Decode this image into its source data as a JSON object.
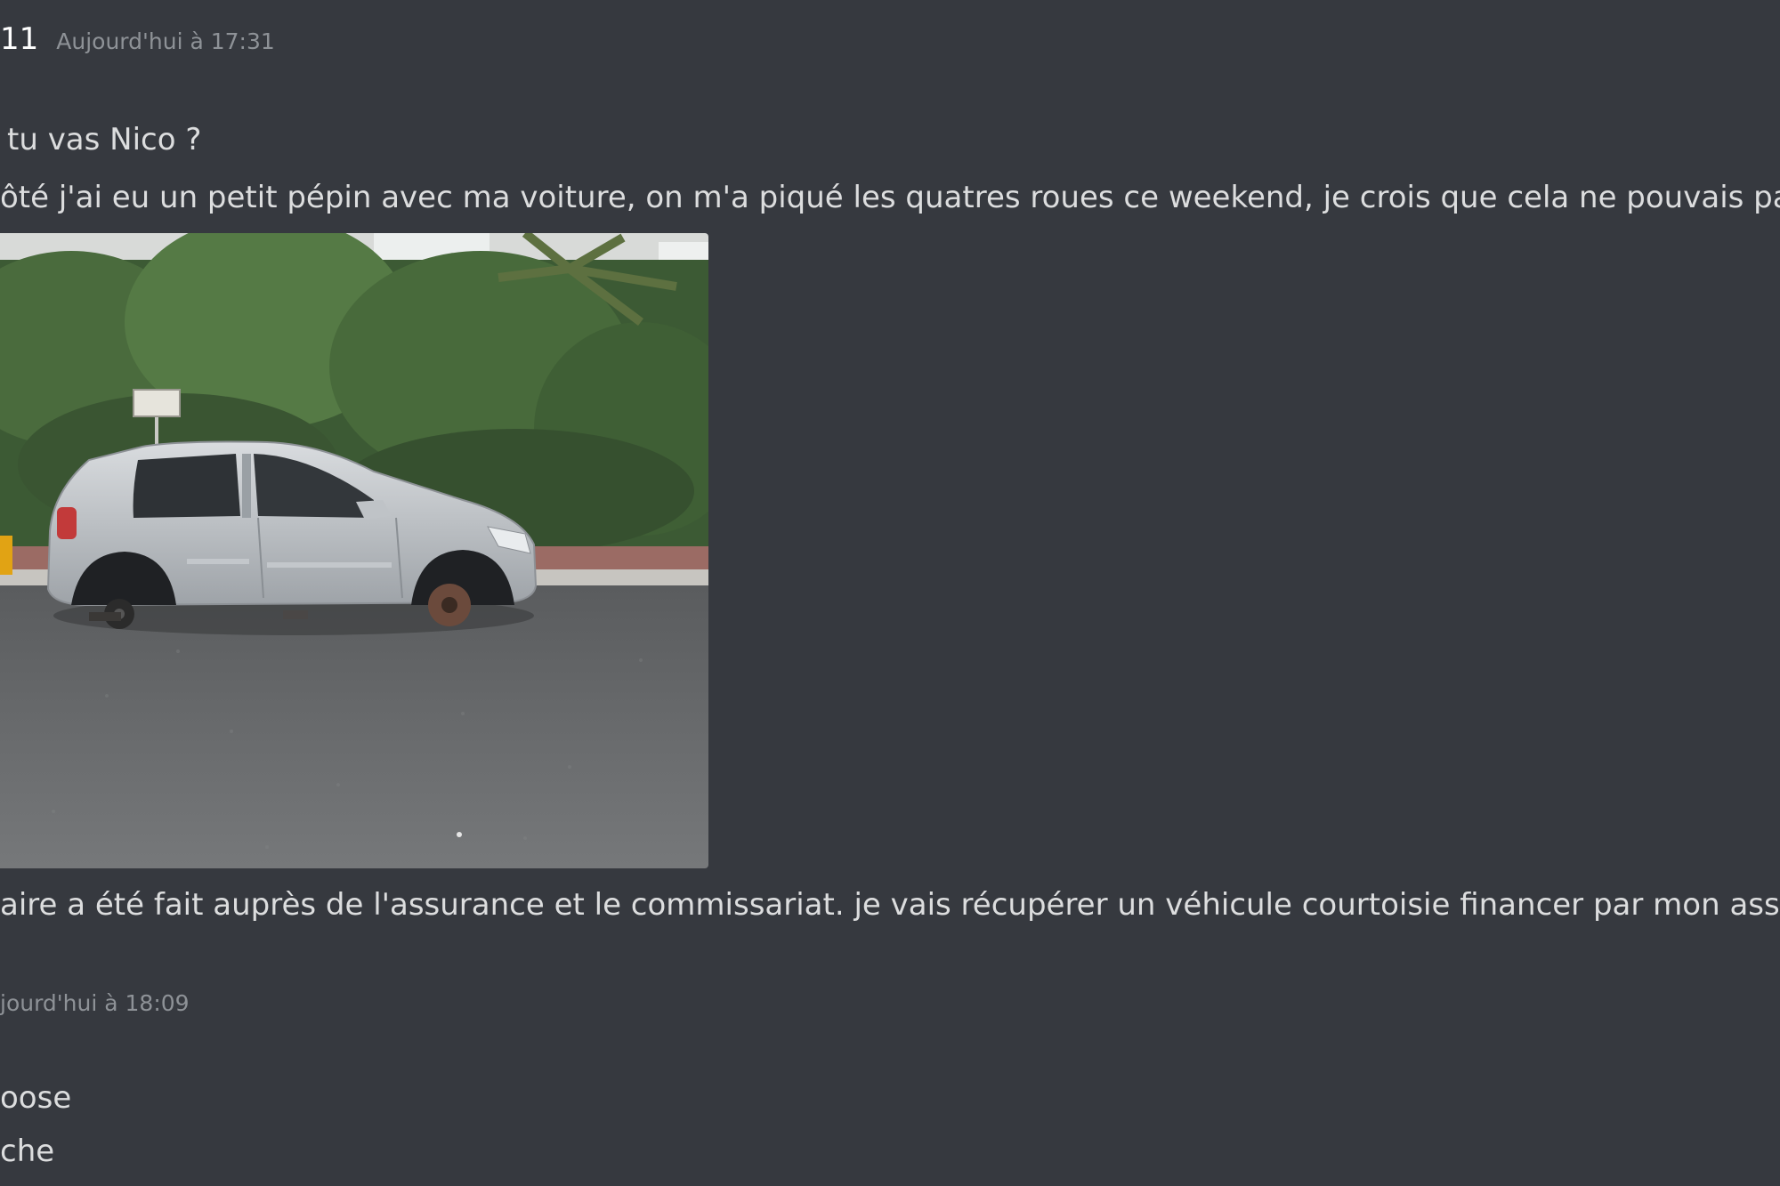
{
  "messages": [
    {
      "author": "11",
      "timestamp": "Aujourd'hui à 17:31",
      "lines": [
        "tu vas Nico ?",
        "ôté j'ai eu un petit pépin avec ma voiture, on m'a piqué les quatres roues ce weekend, je crois que cela ne pouvais pas tomber pl"
      ],
      "after_image": "aire a été fait auprès de l'assurance et le commissariat. je vais récupérer un véhicule courtoisie financer par mon assurance dem"
    },
    {
      "timestamp": "jourd'hui à 18:09",
      "lines": [
        "oose",
        "che"
      ]
    }
  ]
}
